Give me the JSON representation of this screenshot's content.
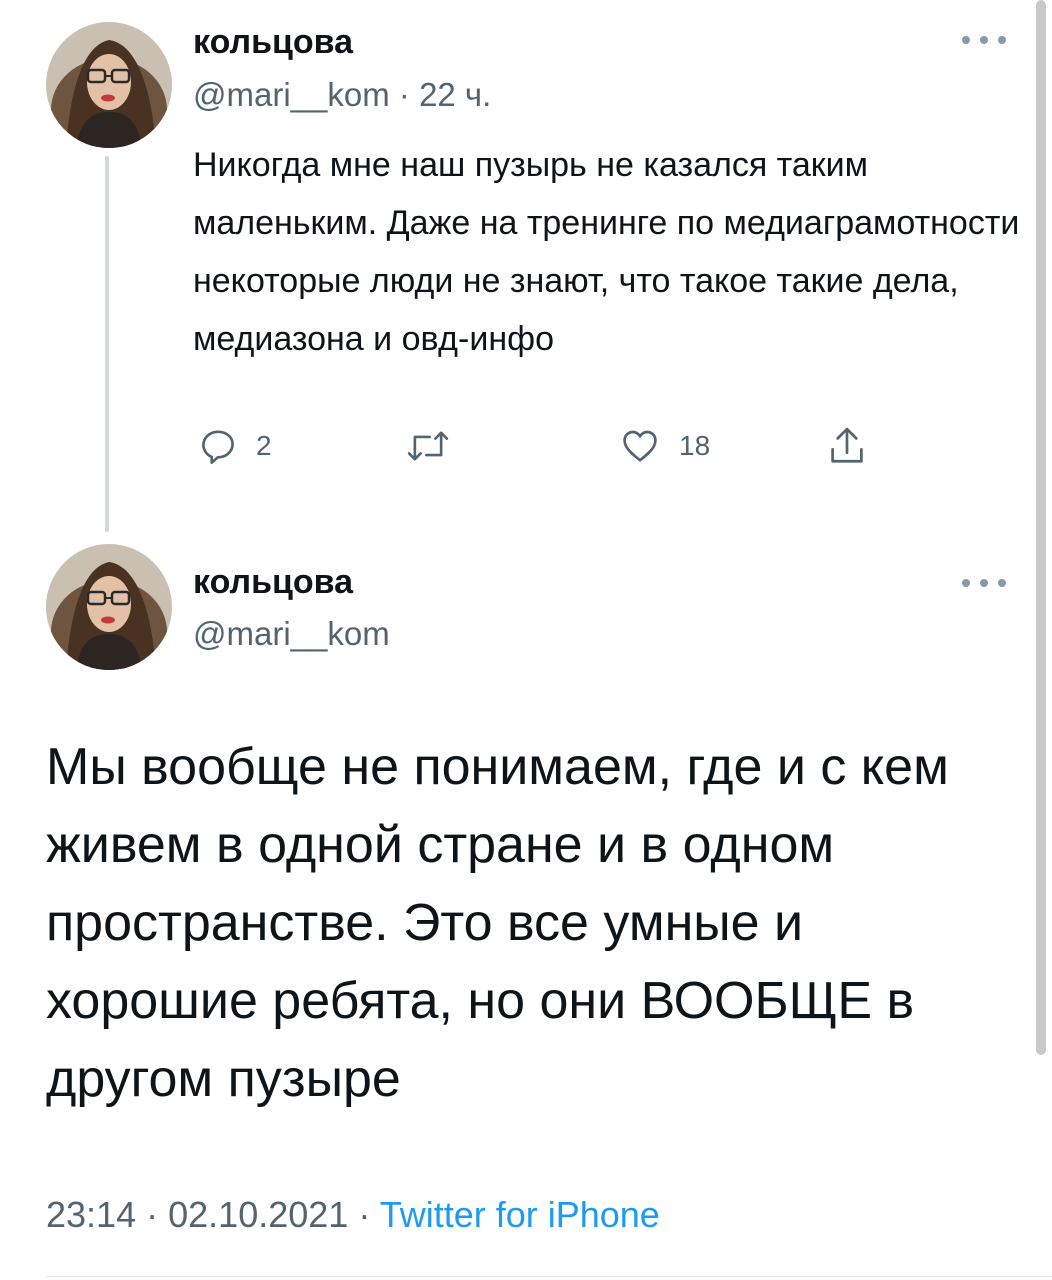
{
  "tweet_parent": {
    "author_name": "кольцова",
    "handle": "@mari__kom",
    "separator": "·",
    "time_ago": "22 ч.",
    "text": "Никогда мне наш пузырь не казался таким маленьким. Даже на тренинге по медиаграмотности некоторые люди не знают, что такое такие дела, медиазона и овд-инфо",
    "actions": {
      "reply_icon": "reply-icon",
      "reply_count": "2",
      "retweet_icon": "retweet-icon",
      "retweet_count": "",
      "like_icon": "like-icon",
      "like_count": "18",
      "share_icon": "share-icon"
    }
  },
  "tweet_main": {
    "author_name": "кольцова",
    "handle": "@mari__kom",
    "text": "Мы вообще не понимаем, где и с кем живем  в одной стране и в одном пространстве. Это все умные и хорошие ребята, но они ВООБЩЕ в другом пузыре",
    "time": "23:14",
    "separator": "·",
    "date": "02.10.2021",
    "separator2": "·",
    "source": "Twitter for iPhone"
  },
  "colors": {
    "text": "#0f1419",
    "secondary": "#536471",
    "link": "#1d9bf0"
  }
}
